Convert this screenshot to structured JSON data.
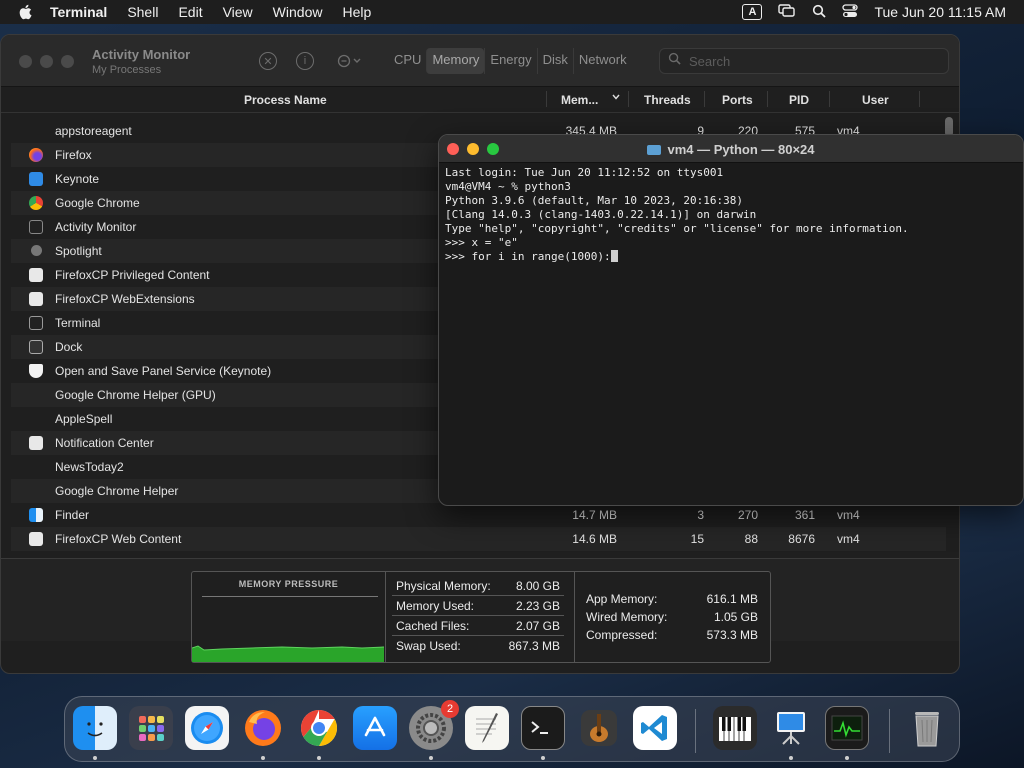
{
  "menubar": {
    "app": "Terminal",
    "items": [
      "Shell",
      "Edit",
      "View",
      "Window",
      "Help"
    ],
    "input_source": "A",
    "datetime": "Tue Jun 20  11:15 AM"
  },
  "activity_monitor": {
    "title": "Activity Monitor",
    "subtitle": "My Processes",
    "tabs": [
      "CPU",
      "Memory",
      "Energy",
      "Disk",
      "Network"
    ],
    "selected_tab": "Memory",
    "search_placeholder": "Search",
    "columns": {
      "name": "Process Name",
      "mem": "Mem...",
      "threads": "Threads",
      "ports": "Ports",
      "pid": "PID",
      "user": "User"
    },
    "rows": [
      {
        "name": "appstoreagent",
        "mem": "345.4 MB",
        "threads": "9",
        "ports": "220",
        "pid": "575",
        "user": "vm4"
      },
      {
        "name": "Firefox",
        "mem": "",
        "threads": "",
        "ports": "",
        "pid": "",
        "user": ""
      },
      {
        "name": "Keynote",
        "mem": "",
        "threads": "",
        "ports": "",
        "pid": "",
        "user": ""
      },
      {
        "name": "Google Chrome",
        "mem": "",
        "threads": "",
        "ports": "",
        "pid": "",
        "user": ""
      },
      {
        "name": "Activity Monitor",
        "mem": "",
        "threads": "",
        "ports": "",
        "pid": "",
        "user": ""
      },
      {
        "name": "Spotlight",
        "mem": "",
        "threads": "",
        "ports": "",
        "pid": "",
        "user": ""
      },
      {
        "name": "FirefoxCP Privileged Content",
        "mem": "",
        "threads": "",
        "ports": "",
        "pid": "",
        "user": ""
      },
      {
        "name": "FirefoxCP WebExtensions",
        "mem": "",
        "threads": "",
        "ports": "",
        "pid": "",
        "user": ""
      },
      {
        "name": "Terminal",
        "mem": "",
        "threads": "",
        "ports": "",
        "pid": "",
        "user": ""
      },
      {
        "name": "Dock",
        "mem": "",
        "threads": "",
        "ports": "",
        "pid": "",
        "user": ""
      },
      {
        "name": "Open and Save Panel Service (Keynote)",
        "mem": "",
        "threads": "",
        "ports": "",
        "pid": "",
        "user": ""
      },
      {
        "name": "Google Chrome Helper (GPU)",
        "mem": "",
        "threads": "",
        "ports": "",
        "pid": "",
        "user": ""
      },
      {
        "name": "AppleSpell",
        "mem": "",
        "threads": "",
        "ports": "",
        "pid": "",
        "user": ""
      },
      {
        "name": "Notification Center",
        "mem": "",
        "threads": "",
        "ports": "",
        "pid": "",
        "user": ""
      },
      {
        "name": "NewsToday2",
        "mem": "",
        "threads": "",
        "ports": "",
        "pid": "",
        "user": ""
      },
      {
        "name": "Google Chrome Helper",
        "mem": "",
        "threads": "",
        "ports": "",
        "pid": "",
        "user": ""
      },
      {
        "name": "Finder",
        "mem": "14.7 MB",
        "threads": "3",
        "ports": "270",
        "pid": "361",
        "user": "vm4"
      },
      {
        "name": "FirefoxCP Web Content",
        "mem": "14.6 MB",
        "threads": "15",
        "ports": "88",
        "pid": "8676",
        "user": "vm4"
      }
    ],
    "memory": {
      "pressure_label": "MEMORY PRESSURE",
      "physical_label": "Physical Memory:",
      "physical": "8.00 GB",
      "used_label": "Memory Used:",
      "used": "2.23 GB",
      "cached_label": "Cached Files:",
      "cached": "2.07 GB",
      "swap_label": "Swap Used:",
      "swap": "867.3 MB",
      "app_label": "App Memory:",
      "app": "616.1 MB",
      "wired_label": "Wired Memory:",
      "wired": "1.05 GB",
      "compressed_label": "Compressed:",
      "compressed": "573.3 MB"
    }
  },
  "terminal": {
    "title": "vm4 — Python — 80×24",
    "lines": [
      "Last login: Tue Jun 20 11:12:52 on ttys001",
      "vm4@VM4 ~ % python3",
      "Python 3.9.6 (default, Mar 10 2023, 20:16:38)",
      "[Clang 14.0.3 (clang-1403.0.22.14.1)] on darwin",
      "Type \"help\", \"copyright\", \"credits\" or \"license\" for more information.",
      ">>> x = \"e\"",
      ">>> for i in range(1000):"
    ]
  },
  "dock": {
    "badge_settings": "2",
    "apps": [
      "Finder",
      "Launchpad",
      "Safari",
      "Firefox",
      "Google Chrome",
      "App Store",
      "System Settings",
      "TextEdit",
      "Terminal",
      "GarageBand",
      "Visual Studio Code",
      "Piano",
      "Keynote",
      "Activity Monitor",
      "Trash"
    ]
  },
  "colors": {
    "menubar": "#1e1e1e",
    "window": "#1f1f1f",
    "terminal_bg": "#1b1b1b",
    "close": "#ff5f57",
    "minimize": "#febc2e",
    "zoom": "#28c840",
    "pressure_green": "#2aa52a"
  }
}
